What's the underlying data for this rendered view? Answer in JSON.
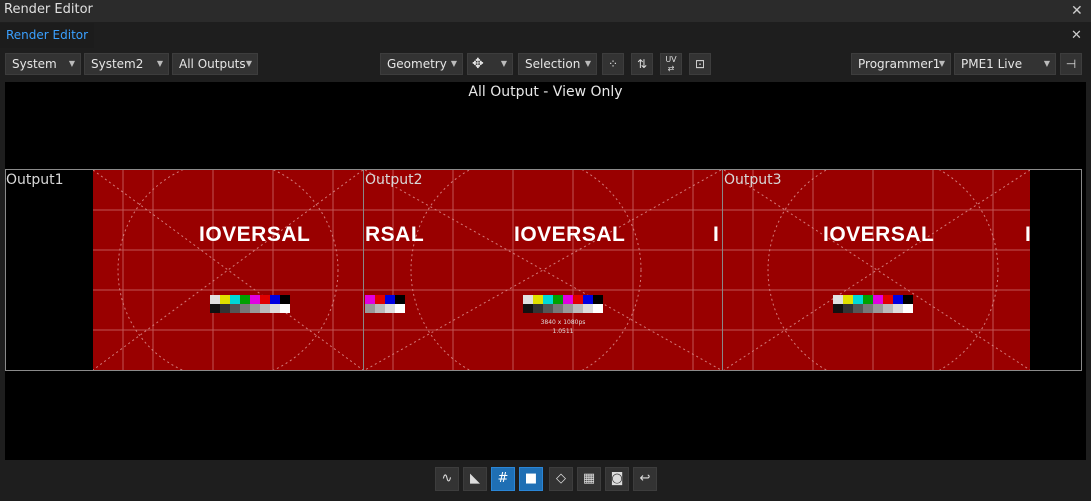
{
  "window": {
    "title": "Render Editor"
  },
  "tab": {
    "label": "Render Editor"
  },
  "toolbar": {
    "system": "System",
    "system2": "System2",
    "outputs": "All Outputs",
    "mode": "Geometry",
    "selection": "Selection",
    "programmer": "Programmer1",
    "live": "PME1 Live",
    "uv_label": "UV"
  },
  "viewport": {
    "title": "All Output - View Only",
    "outputs": [
      {
        "label": "Output1"
      },
      {
        "label": "Output2"
      },
      {
        "label": "Output3"
      }
    ],
    "logo_text": "IOVERSAL",
    "logo_fragment_left": "RSAL",
    "logo_fragment_right": "I",
    "resolution_text": "3840 x 1080ps",
    "fps_text": "1.0511",
    "background_color": "#990000"
  },
  "bottom_tools": [
    {
      "icon": "waveform-icon",
      "active": false
    },
    {
      "icon": "triangle-icon",
      "active": false
    },
    {
      "icon": "grid-icon",
      "active": true
    },
    {
      "icon": "camera-icon",
      "active": true
    },
    {
      "icon": "projector-icon",
      "active": false
    },
    {
      "icon": "table-icon",
      "active": false
    },
    {
      "icon": "screenshot-icon",
      "active": false
    },
    {
      "icon": "undo-icon",
      "active": false
    }
  ]
}
